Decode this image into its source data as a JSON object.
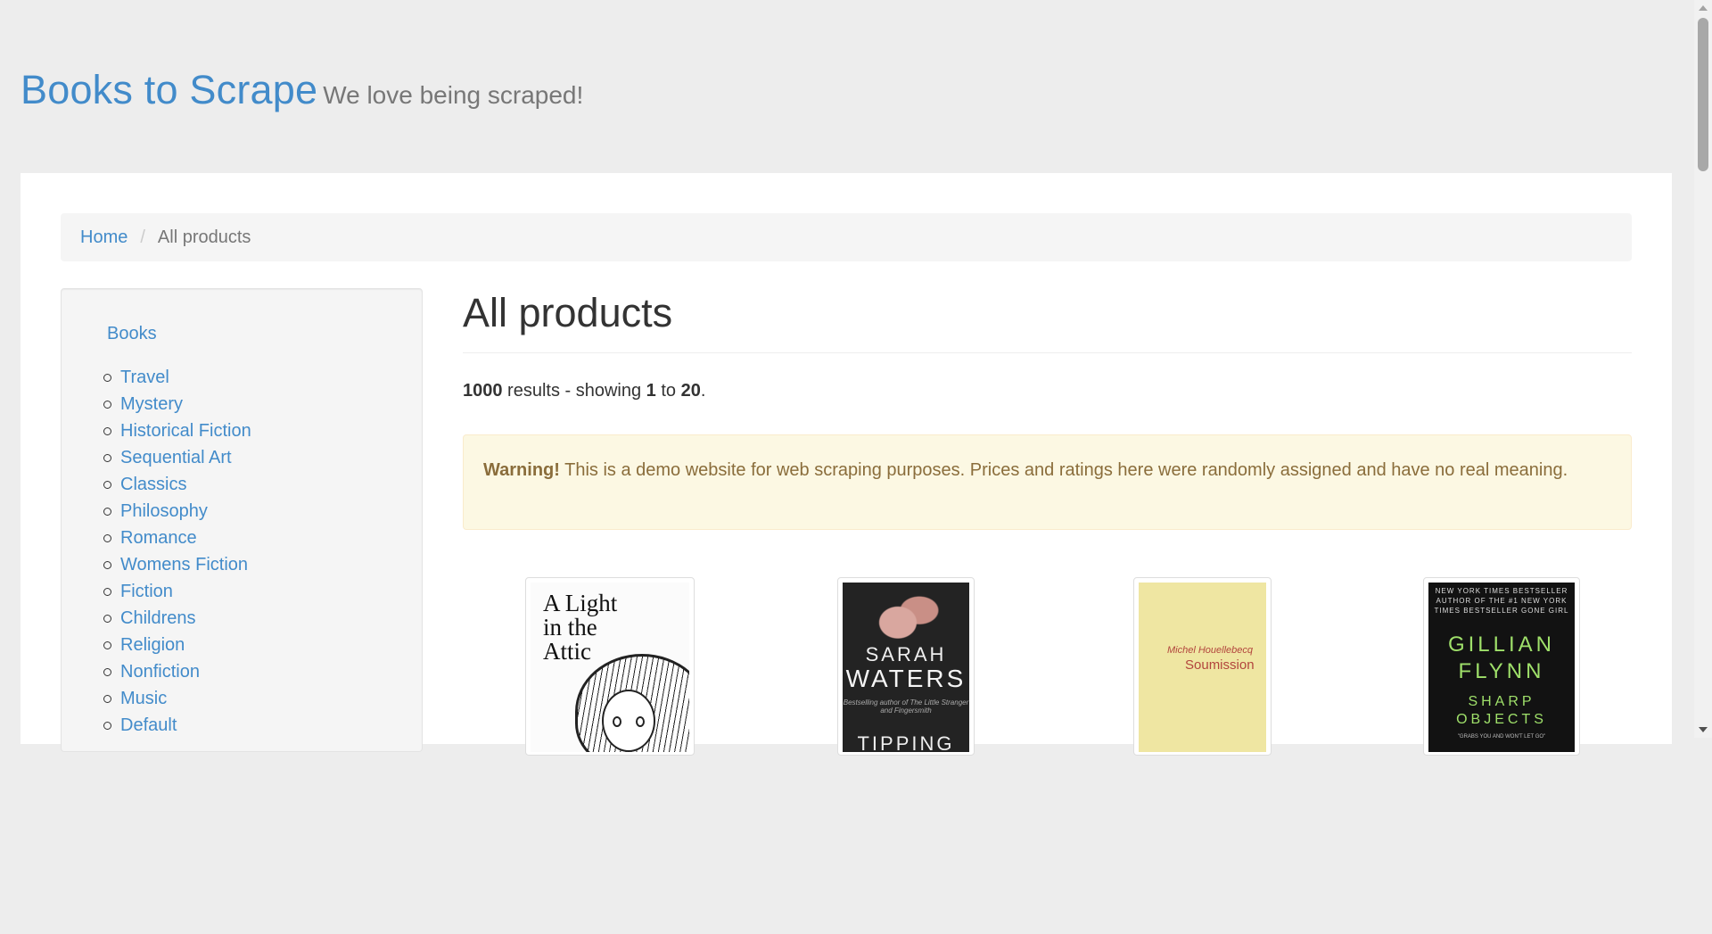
{
  "header": {
    "brand": "Books to Scrape",
    "tagline": "We love being scraped!"
  },
  "breadcrumb": {
    "home": "Home",
    "separator": "/",
    "current": "All products"
  },
  "sidebar": {
    "top_label": "Books",
    "categories": [
      "Travel",
      "Mystery",
      "Historical Fiction",
      "Sequential Art",
      "Classics",
      "Philosophy",
      "Romance",
      "Womens Fiction",
      "Fiction",
      "Childrens",
      "Religion",
      "Nonfiction",
      "Music",
      "Default"
    ]
  },
  "main": {
    "title": "All products",
    "results": {
      "total": "1000",
      "text1": " results - showing ",
      "from": "1",
      "text2": " to ",
      "to": "20",
      "end": "."
    },
    "alert": {
      "strong": "Warning!",
      "message": " This is a demo website for web scraping purposes. Prices and ratings here were randomly assigned and have no real meaning."
    }
  },
  "books": [
    {
      "cover_title": "A Light in the Attic",
      "cover_lines": [
        "A Light",
        "in the",
        "Attic"
      ]
    },
    {
      "cover_lines": [
        "SARAH",
        "WATERS",
        "Bestselling author of The Little Stranger and Fingersmith",
        "TIPPING"
      ]
    },
    {
      "cover_lines": [
        "Michel Houellebecq",
        "Soumission"
      ]
    },
    {
      "cover_lines": [
        "NEW YORK TIMES BESTSELLER",
        "AUTHOR OF THE #1 NEW YORK TIMES BESTSELLER GONE GIRL",
        "GILLIAN",
        "FLYNN",
        "SHARP",
        "OBJECTS",
        "\"GRABS YOU AND WON'T LET GO\""
      ]
    }
  ],
  "colors": {
    "link": "#428bca",
    "alert_bg": "#fcf8e3",
    "alert_text": "#8a6d3b",
    "page_bg": "#ededed"
  }
}
